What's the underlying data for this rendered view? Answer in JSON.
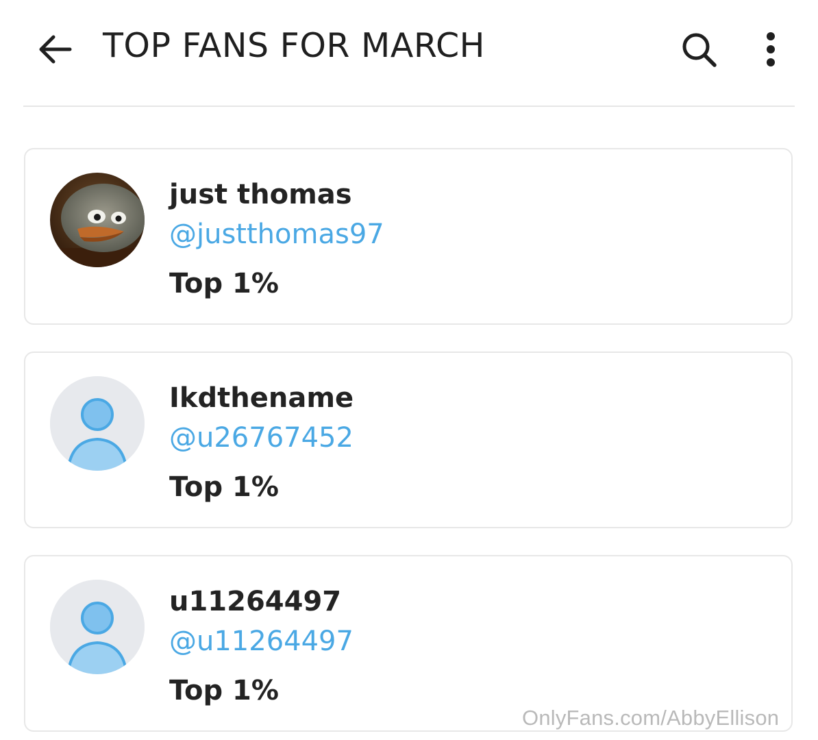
{
  "header": {
    "title": "TOP FANS FOR MARCH",
    "back_icon": "arrow-left-icon",
    "search_icon": "search-icon",
    "more_icon": "more-vertical-icon"
  },
  "fans": [
    {
      "name": "just thomas",
      "handle": "@justthomas97",
      "rank": "Top 1%",
      "avatar": "profile-photo"
    },
    {
      "name": "Ikdthename",
      "handle": "@u26767452",
      "rank": "Top 1%",
      "avatar": "default-avatar-icon"
    },
    {
      "name": "u11264497",
      "handle": "@u11264497",
      "rank": "Top 1%",
      "avatar": "default-avatar-icon"
    }
  ],
  "watermark": "OnlyFans.com/AbbyEllison",
  "colors": {
    "accent": "#4aa8e4",
    "text": "#232323",
    "border": "#e7e7e7",
    "avatar_bg": "#e7e9ed"
  }
}
